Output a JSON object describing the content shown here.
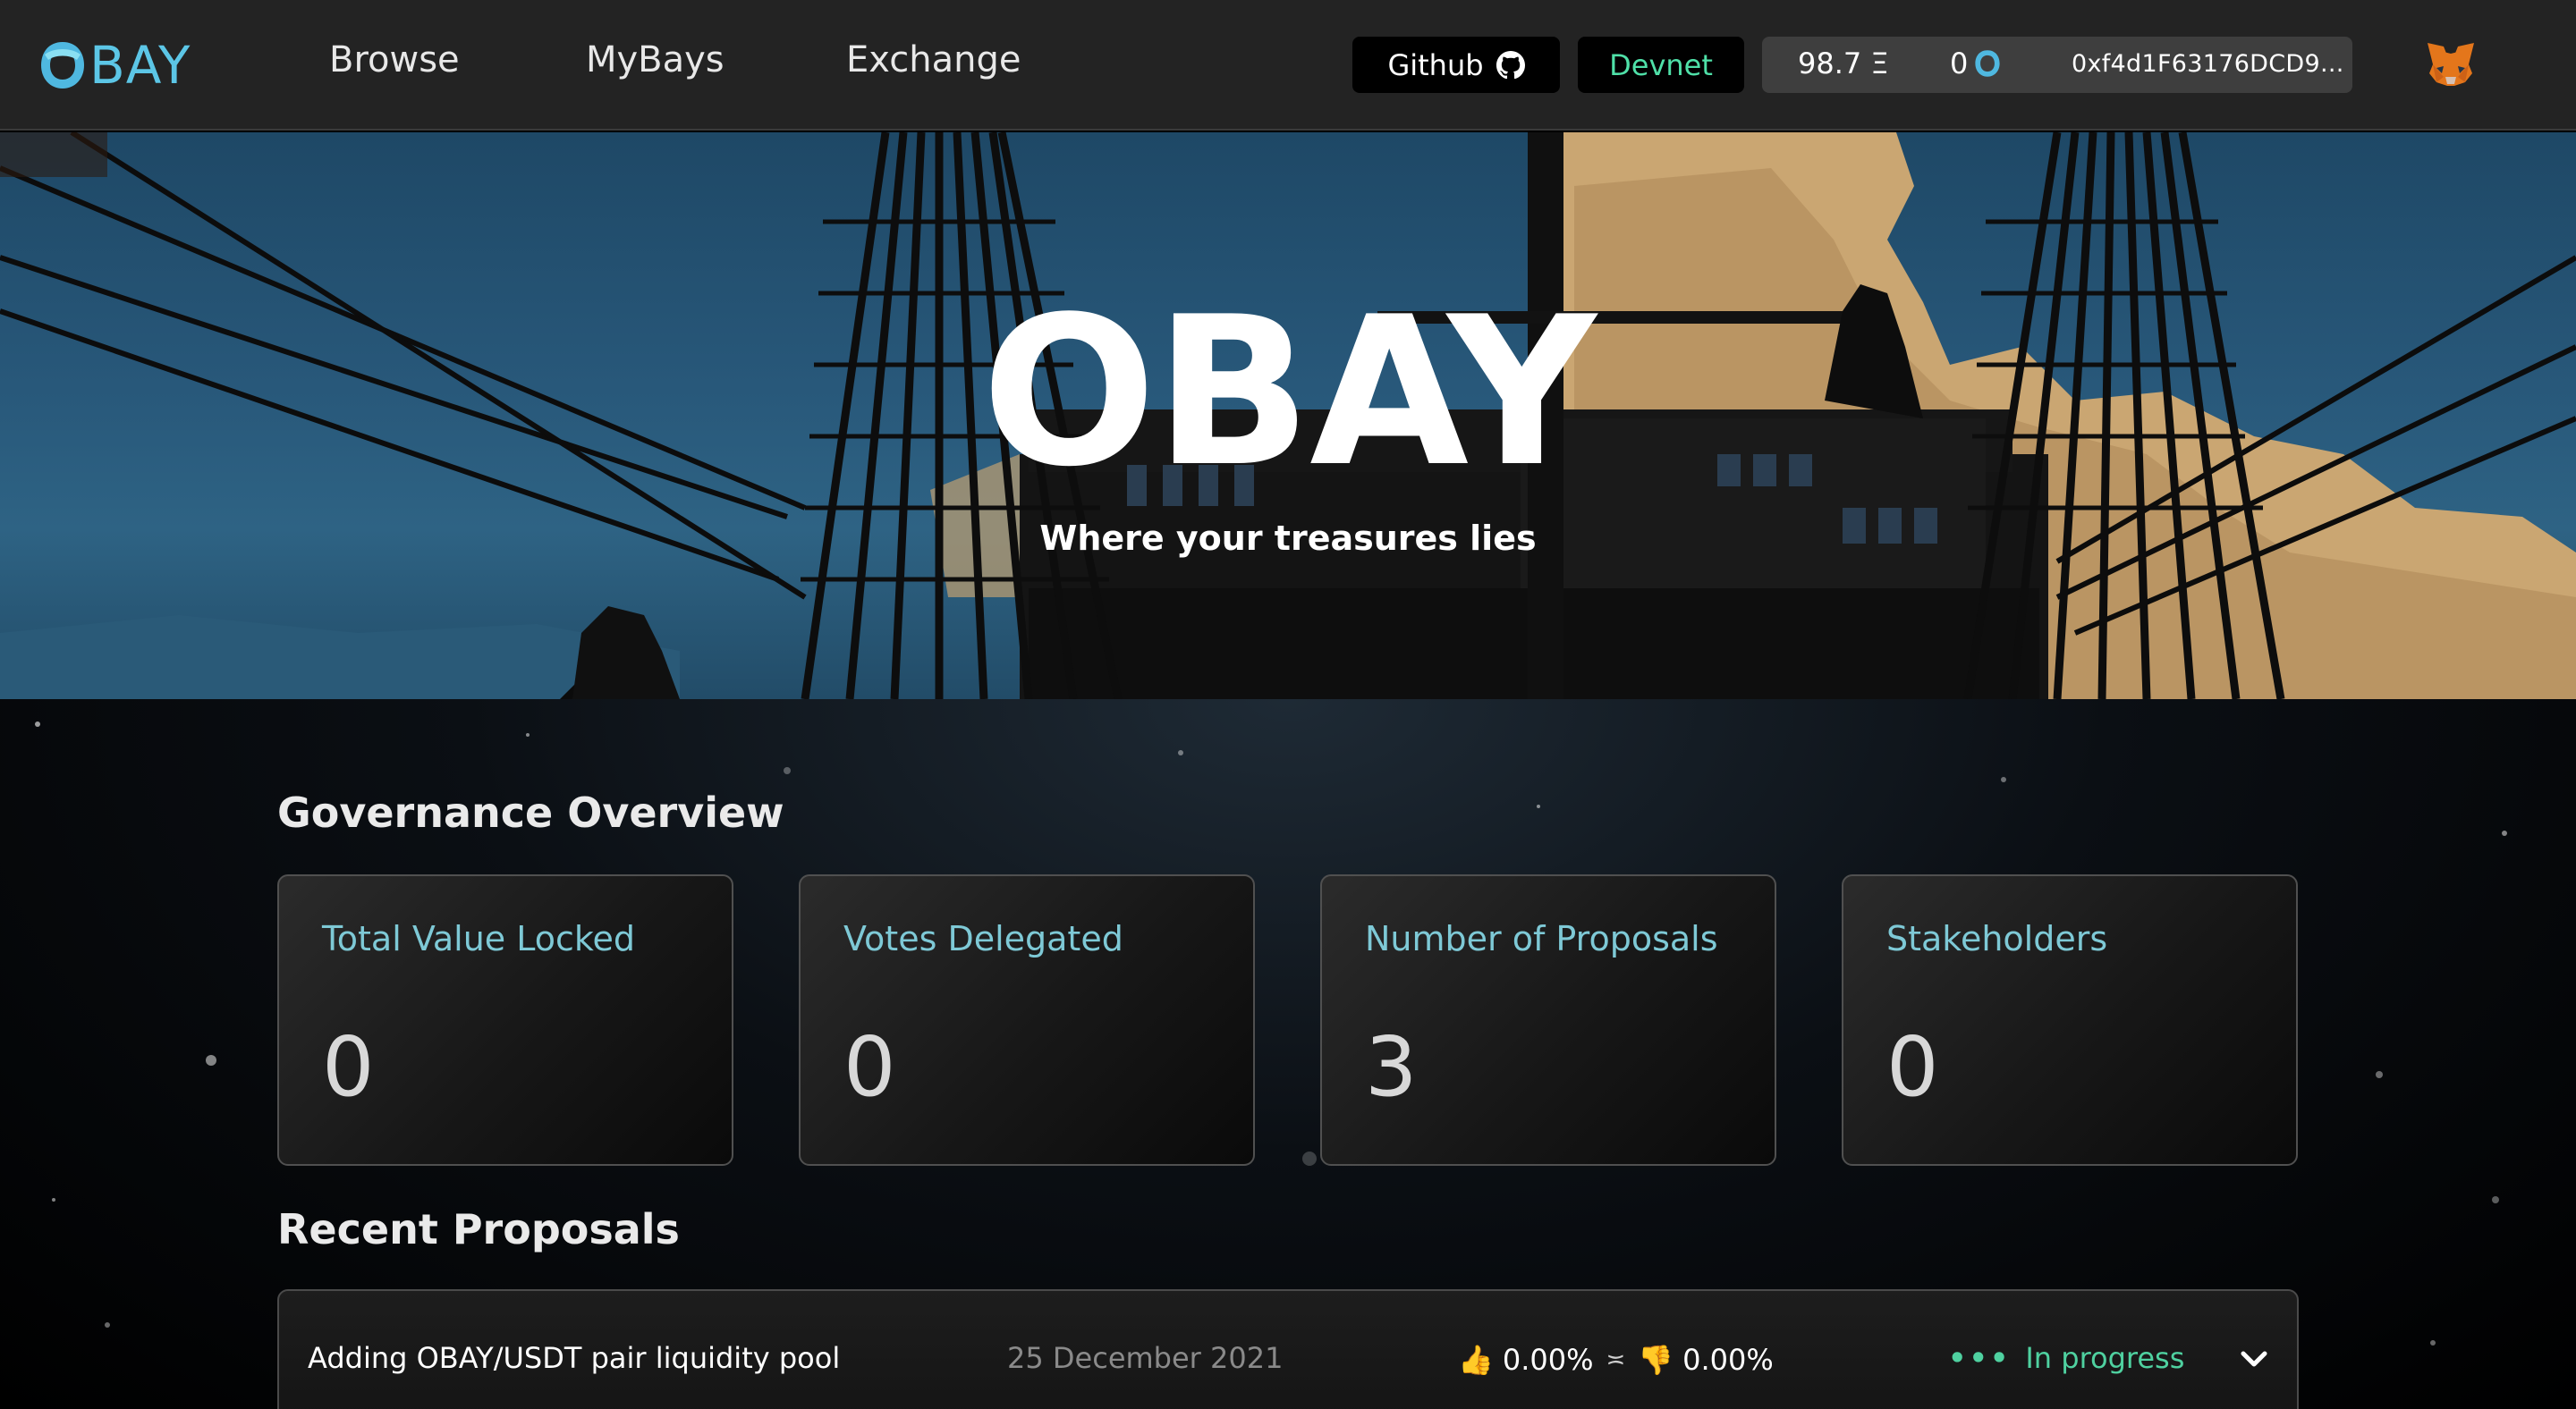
{
  "nav": {
    "logo_text": "BAY",
    "links": [
      "Browse",
      "MyBays",
      "Exchange"
    ],
    "github_label": "Github",
    "network_label": "Devnet",
    "eth_balance": "98.7 Ξ",
    "obay_balance": "0",
    "address": "0xf4d1F63176DCD9...",
    "icons": {
      "logo": "obay-logo-icon",
      "github": "github-icon",
      "obay_token": "obay-token-icon",
      "wallet": "metamask-fox-icon"
    }
  },
  "hero": {
    "title": "OBAY",
    "subtitle": "Where your treasures lies"
  },
  "governance": {
    "title": "Governance Overview",
    "cards": [
      {
        "label": "Total Value Locked",
        "value": "0"
      },
      {
        "label": "Votes Delegated",
        "value": "0"
      },
      {
        "label": "Number of Proposals",
        "value": "3"
      },
      {
        "label": "Stakeholders",
        "value": "0"
      }
    ]
  },
  "recent": {
    "title": "Recent Proposals",
    "proposals": [
      {
        "title": "Adding OBAY/USDT pair liquidity pool",
        "date": "25 December 2021",
        "yes": "0.00%",
        "no": "0.00%",
        "separator": "≍",
        "status_dots": "•••",
        "status": "In progress"
      }
    ]
  },
  "colors": {
    "accent_teal": "#7ec9d6",
    "logo_blue": "#5cc6e6",
    "status_green": "#4fd1a0",
    "devnet_green": "#4fe0a8",
    "navbar_bg": "#232323"
  }
}
